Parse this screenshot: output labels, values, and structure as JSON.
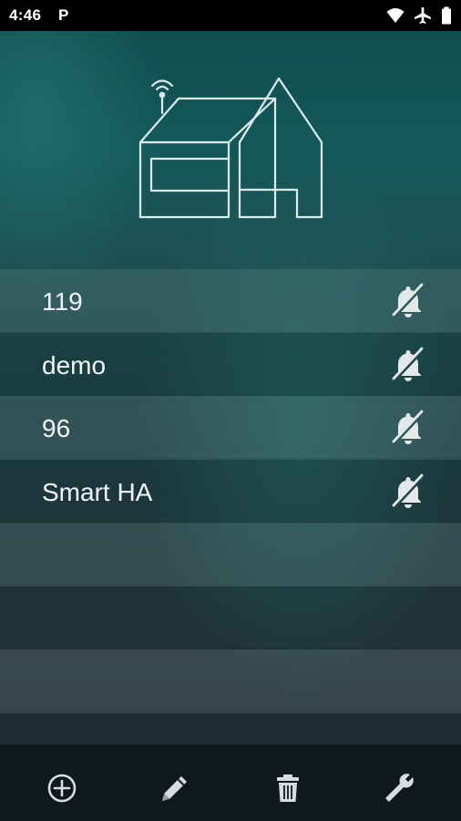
{
  "status_bar": {
    "time": "4:46",
    "notification_letter": "P",
    "icons": [
      "wifi-icon",
      "airplane-icon",
      "battery-icon"
    ]
  },
  "header": {
    "logo": "house-with-antenna-icon"
  },
  "list": {
    "items": [
      {
        "label": "119",
        "icon": "notifications-off-icon"
      },
      {
        "label": "demo",
        "icon": "notifications-off-icon"
      },
      {
        "label": "96",
        "icon": "notifications-off-icon"
      },
      {
        "label": "Smart HA",
        "icon": "notifications-off-icon"
      }
    ],
    "empty_rows": 4
  },
  "toolbar": {
    "buttons": [
      {
        "icon": "add-circle-icon"
      },
      {
        "icon": "pencil-icon"
      },
      {
        "icon": "trash-icon"
      },
      {
        "icon": "wrench-icon"
      }
    ]
  },
  "colors": {
    "accent_teal": "#14595a",
    "text": "#f2f5f5",
    "toolbar_bg": "#0f191c",
    "status_bar_bg": "#000000"
  }
}
